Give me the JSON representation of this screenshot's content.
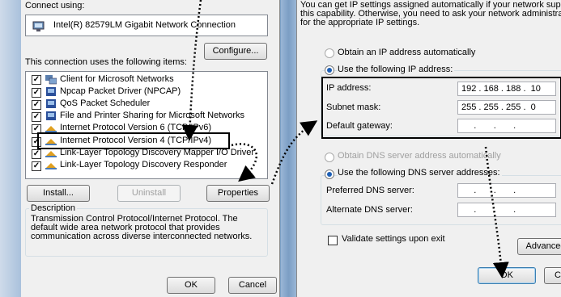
{
  "left": {
    "connect_using_label": "Connect using:",
    "adapter_name": "Intel(R) 82579LM Gigabit Network Connection",
    "configure_button": "Configure...",
    "items_label": "This connection uses the following items:",
    "items": [
      {
        "label": "Client for Microsoft Networks",
        "checked": true
      },
      {
        "label": "Npcap Packet Driver (NPCAP)",
        "checked": true
      },
      {
        "label": "QoS Packet Scheduler",
        "checked": true
      },
      {
        "label": "File and Printer Sharing for Microsoft Networks",
        "checked": true
      },
      {
        "label": "Internet Protocol Version 6 (TCP/IPv6)",
        "checked": true
      },
      {
        "label": "Internet Protocol Version 4 (TCP/IPv4)",
        "checked": true
      },
      {
        "label": "Link-Layer Topology Discovery Mapper I/O Driver",
        "checked": true
      },
      {
        "label": "Link-Layer Topology Discovery Responder",
        "checked": true
      }
    ],
    "install_button": "Install...",
    "uninstall_button": "Uninstall",
    "properties_button": "Properties",
    "description_label": "Description",
    "description_text": "Transmission Control Protocol/Internet Protocol. The default wide area network protocol that provides communication across diverse interconnected networks.",
    "ok_button": "OK",
    "cancel_button": "Cancel"
  },
  "right": {
    "intro_text_1": "You can get IP settings assigned automatically if your network supp",
    "intro_text_2": "this capability. Otherwise, you need to ask your network administrat",
    "intro_text_3": "for the appropriate IP settings.",
    "obtain_ip_auto": "Obtain an IP address automatically",
    "use_following_ip": "Use the following IP address:",
    "ip_address_label": "IP address:",
    "ip_address_value": "192 . 168 . 188 .  10",
    "subnet_mask_label": "Subnet mask:",
    "subnet_mask_value": "255 . 255 . 255 .  0",
    "default_gateway_label": "Default gateway:",
    "default_gateway_value": "     .       .       .",
    "obtain_dns_auto": "Obtain DNS server address automatically",
    "use_following_dns": "Use the following DNS server addresses:",
    "preferred_dns_label": "Preferred DNS server:",
    "preferred_dns_value": "     .       .       .",
    "alternate_dns_label": "Alternate DNS server:",
    "alternate_dns_value": "     .       .       .",
    "validate_label": "Validate settings upon exit",
    "advanced_button": "Advanced",
    "ok_button": "OK",
    "cancel_button": "Ca"
  },
  "colors": {
    "annotation": "#000000",
    "selection_ring": "#3c7fb1"
  }
}
